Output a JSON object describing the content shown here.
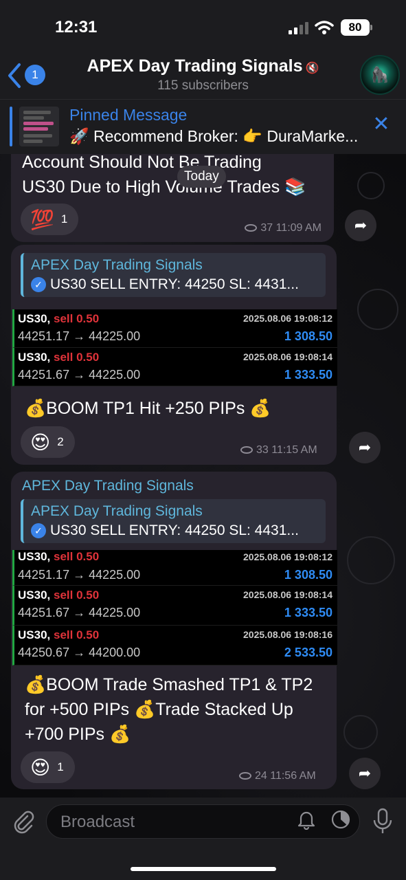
{
  "status": {
    "time": "12:31",
    "battery": "80"
  },
  "header": {
    "back_count": "1",
    "title": "APEX Day Trading Signals",
    "subtitle": "115 subscribers",
    "mute_icon": "🔇"
  },
  "pinned": {
    "label": "Pinned Message",
    "text": "🚀 Recommend Broker: 👉 DuraMarke..."
  },
  "date_chip": "Today",
  "messages": [
    {
      "text_line1": "Account Should Not Be Trading",
      "text_line2": "US30 Due to High Volume Trades 📚",
      "reaction_emoji": "💯",
      "reaction_count": "1",
      "views": "37",
      "time": "11:09 AM"
    },
    {
      "quote_name": "APEX Day Trading Signals",
      "quote_text": "US30 SELL ENTRY: 44250 SL: 4431...",
      "trades": [
        {
          "symbol": "US30,",
          "side": "sell 0.50",
          "date": "2025.08.06 19:08:12",
          "prices": "44251.17 → 44225.00",
          "profit": "1 308.50"
        },
        {
          "symbol": "US30,",
          "side": "sell 0.50",
          "date": "2025.08.06 19:08:14",
          "prices": "44251.67 → 44225.00",
          "profit": "1 333.50"
        }
      ],
      "text": "💰BOOM TP1 Hit +250 PIPs 💰",
      "reaction_emoji": "😍",
      "reaction_count": "2",
      "views": "33",
      "time": "11:15 AM"
    },
    {
      "forward_name": "APEX Day Trading Signals",
      "quote_name": "APEX Day Trading Signals",
      "quote_text": "US30 SELL ENTRY: 44250 SL: 4431...",
      "trades": [
        {
          "symbol": "US30,",
          "side": "sell 0.50",
          "date": "2025.08.06 19:08:12",
          "prices": "44251.17 → 44225.00",
          "profit": "1 308.50"
        },
        {
          "symbol": "US30,",
          "side": "sell 0.50",
          "date": "2025.08.06 19:08:14",
          "prices": "44251.67 → 44225.00",
          "profit": "1 333.50"
        },
        {
          "symbol": "US30,",
          "side": "sell 0.50",
          "date": "2025.08.06 19:08:16",
          "prices": "44250.67 → 44200.00",
          "profit": "2 533.50"
        }
      ],
      "text_line1": "💰BOOM Trade Smashed TP1 & TP2",
      "text_line2": "for +500 PIPs 💰Trade Stacked Up",
      "text_line3": "+700 PIPs 💰",
      "reaction_emoji": "😍",
      "reaction_count": "1",
      "views": "24",
      "time": "11:56 AM"
    }
  ],
  "composer": {
    "placeholder": "Broadcast"
  },
  "colors": {
    "accent": "#3a83e8",
    "bubble": "#27232d",
    "link": "#5fb7dc",
    "sell": "#e0333a",
    "profit": "#2f8cf5",
    "trade_bar": "#22a742"
  }
}
